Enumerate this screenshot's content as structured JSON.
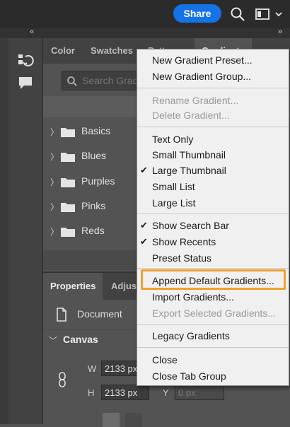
{
  "topbar": {
    "share_label": "Share",
    "icons": [
      "search-icon",
      "workspace-icon",
      "chevron-down-icon"
    ],
    "accent": "#1473e6"
  },
  "collapse_strip": {
    "left_glyph": "«",
    "right_glyph": "»"
  },
  "tools": [
    "rotate-view-icon",
    "comment-icon"
  ],
  "panel": {
    "tabs": [
      "Color",
      "Swatches",
      "Patterns",
      "Gradients"
    ],
    "active_tab": "Gradients",
    "search_placeholder": "Search Gradients",
    "groups": [
      "Basics",
      "Blues",
      "Purples",
      "Pinks",
      "Reds"
    ]
  },
  "properties": {
    "tabs": [
      "Properties",
      "Adjustments"
    ],
    "document_label": "Document",
    "section_title": "Canvas",
    "width_label": "W",
    "width_value": "2133 px",
    "height_label": "H",
    "height_value": "2133 px",
    "y_label": "Y",
    "y_value": "0 px"
  },
  "menu": {
    "items": [
      {
        "label": "New Gradient Preset...",
        "disabled": false,
        "checked": false
      },
      {
        "label": "New Gradient Group...",
        "disabled": false,
        "checked": false
      },
      {
        "label": "Rename Gradient...",
        "disabled": true,
        "checked": false
      },
      {
        "label": "Delete Gradient...",
        "disabled": true,
        "checked": false
      },
      {
        "label": "Text Only",
        "disabled": false,
        "checked": false
      },
      {
        "label": "Small Thumbnail",
        "disabled": false,
        "checked": false
      },
      {
        "label": "Large Thumbnail",
        "disabled": false,
        "checked": true
      },
      {
        "label": "Small List",
        "disabled": false,
        "checked": false
      },
      {
        "label": "Large List",
        "disabled": false,
        "checked": false
      },
      {
        "label": "Show Search Bar",
        "disabled": false,
        "checked": true
      },
      {
        "label": "Show Recents",
        "disabled": false,
        "checked": true
      },
      {
        "label": "Preset Status",
        "disabled": false,
        "checked": false
      },
      {
        "label": "Append Default Gradients...",
        "disabled": false,
        "checked": false,
        "highlighted": true
      },
      {
        "label": "Import Gradients...",
        "disabled": false,
        "checked": false
      },
      {
        "label": "Export Selected Gradients...",
        "disabled": true,
        "checked": false
      },
      {
        "label": "Legacy Gradients",
        "disabled": false,
        "checked": false
      },
      {
        "label": "Close",
        "disabled": false,
        "checked": false
      },
      {
        "label": "Close Tab Group",
        "disabled": false,
        "checked": false
      }
    ],
    "check_glyph": "✔",
    "highlight_color": "#f0a030"
  }
}
